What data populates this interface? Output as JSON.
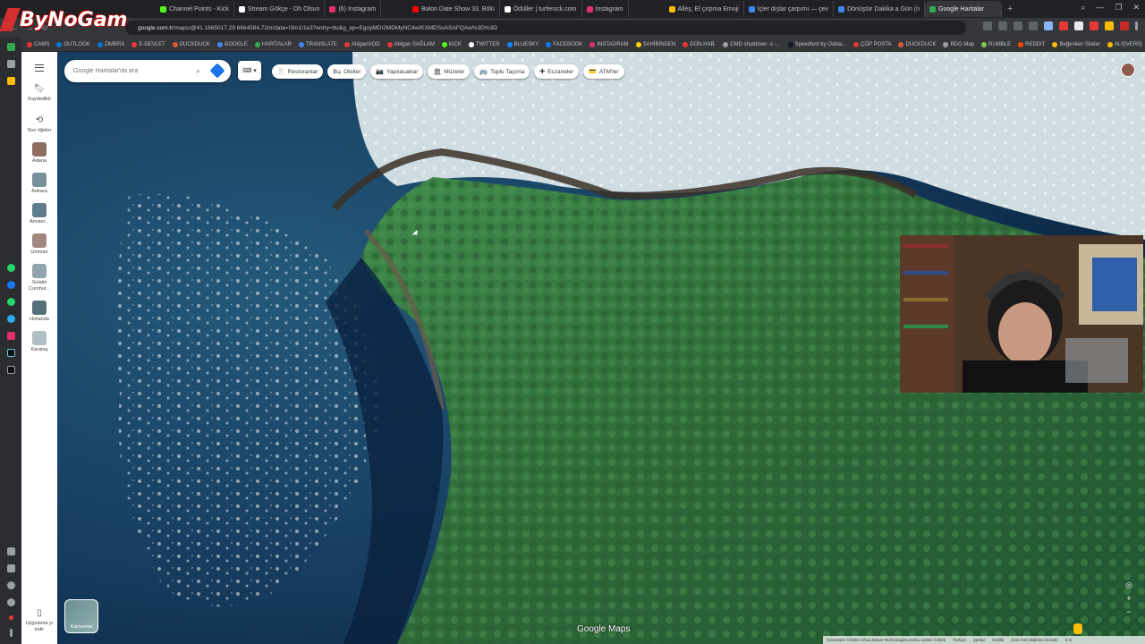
{
  "browser": {
    "tabs": [
      {
        "title": "Channel Points - Kick",
        "color": "#53fc18"
      },
      {
        "title": "İnsan... Engesel",
        "color": "#ffffff"
      },
      {
        "title": "Stream Gökçe - Oh Olsun",
        "color": "#ff0000"
      },
      {
        "title": "(6) Instagram",
        "color": "#e1306c"
      },
      {
        "title": "Balon Date Show 33. Bölü",
        "color": "#ff0000"
      },
      {
        "title": "Ödüller | turferock.com",
        "color": "#ffffff"
      },
      {
        "title": "Instagram",
        "color": "#e1306c"
      },
      {
        "title": "Alleş, El çırpma Emoji",
        "color": "#fbbc04"
      },
      {
        "title": "İçler dışlar çarpımı — çev",
        "color": "#4285f4"
      },
      {
        "title": "Dönüştür Dakika a Gün (n",
        "color": "#4285f4"
      },
      {
        "title": "Google Haritalar",
        "color": "#34a853",
        "active": true
      }
    ],
    "new_tab": "+",
    "url_domain": "google.com.tr",
    "url_path": "/maps/@41.1665017,29.6664584,72m/data=!3m1!1e3?entry=ttu&g_ep=EgoyMDI2MDMyNC4wIKXMDSoASAFQAw%3D%3D",
    "window_controls": [
      "⌄",
      "—",
      "❐",
      "✕"
    ],
    "bookmarks": [
      {
        "label": "CAMS",
        "color": "#e53935"
      },
      {
        "label": "OUTLOOK",
        "color": "#0078d4"
      },
      {
        "label": "ZIMBRA",
        "color": "#0078d4"
      },
      {
        "label": "E-DEVLET",
        "color": "#e53935"
      },
      {
        "label": "DUCKDUCK",
        "color": "#de5833"
      },
      {
        "label": "GOOGLE",
        "color": "#4285f4"
      },
      {
        "label": "HARİTALAR",
        "color": "#34a853"
      },
      {
        "label": "TRANSLATE",
        "color": "#4285f4"
      },
      {
        "label": "AtılganVOD",
        "color": "#e53935"
      },
      {
        "label": "Atılgan SAĞLAM",
        "color": "#e53935"
      },
      {
        "label": "KICK",
        "color": "#53fc18"
      },
      {
        "label": "TWITTER",
        "color": "#ffffff"
      },
      {
        "label": "BLUESKY",
        "color": "#1185fe"
      },
      {
        "label": "FACEBOOK",
        "color": "#1877f2"
      },
      {
        "label": "INSTAGRAM",
        "color": "#e1306c"
      },
      {
        "label": "SAHİBİNDEN",
        "color": "#ffd400"
      },
      {
        "label": "DON.HAB.",
        "color": "#e53935"
      },
      {
        "label": "CMD shutdown -s -...",
        "color": "#9e9e9e"
      },
      {
        "label": "Speedtest by Ookla...",
        "color": "#141526"
      },
      {
        "label": "ÇÖP POSTA",
        "color": "#e53935"
      },
      {
        "label": "DUCKDUCK",
        "color": "#de5833"
      },
      {
        "label": "RDO Map",
        "color": "#9e9e9e"
      },
      {
        "label": "RUMBLE",
        "color": "#85c742"
      },
      {
        "label": "REDDIT",
        "color": "#ff4500"
      },
      {
        "label": "Beğenilen Siteler",
        "color": "#fbbc04"
      },
      {
        "label": "ALIŞVERİŞ",
        "color": "#fbbc04"
      }
    ]
  },
  "overlay": {
    "logo_text": "ByNoGam"
  },
  "maps": {
    "search_placeholder": "Google Haritalar'da ara",
    "chips": [
      {
        "icon": "🍴",
        "label": "Restoranlar"
      },
      {
        "icon": "🛏",
        "label": "Oteller"
      },
      {
        "icon": "📷",
        "label": "Yapılacaklar"
      },
      {
        "icon": "🏛",
        "label": "Müzeler"
      },
      {
        "icon": "🚌",
        "label": "Toplu Taşıma"
      },
      {
        "icon": "✚",
        "label": "Eczaneler"
      },
      {
        "icon": "💳",
        "label": "ATM'ler"
      }
    ],
    "sidebar": {
      "saved": "Kaydedildi",
      "recent": "Son öğeler",
      "places": [
        {
          "label": "Adana",
          "color": "#8d6e63"
        },
        {
          "label": "Ankara",
          "color": "#78909c"
        },
        {
          "label": "Amster...",
          "color": "#607d8b"
        },
        {
          "label": "Umman",
          "color": "#a1887f"
        },
        {
          "label": "Solaklı Cumhur...",
          "color": "#90a4ae"
        },
        {
          "label": "Hollanda",
          "color": "#546e7a"
        },
        {
          "label": "Karataş",
          "color": "#b0bec5"
        }
      ],
      "apps": "Uygulama yı indir"
    },
    "layer_thumb_label": "Katmanlar",
    "brand": "Google Maps",
    "attribution": [
      "Görüntüler ©2026 Airbus,Maxar Technologies,Harita verileri ©2026",
      "Türkiye",
      "Şartlar",
      "Gizlilik",
      "Ürün Geri Bildirimi Gönder",
      "5 m"
    ]
  },
  "colors": {
    "sea_deep": "#0b2744",
    "sea_mid": "#1c4a6b",
    "forest": "#2f6a3a",
    "surf": "#dfe7ea",
    "accent": "#1a73e8"
  }
}
